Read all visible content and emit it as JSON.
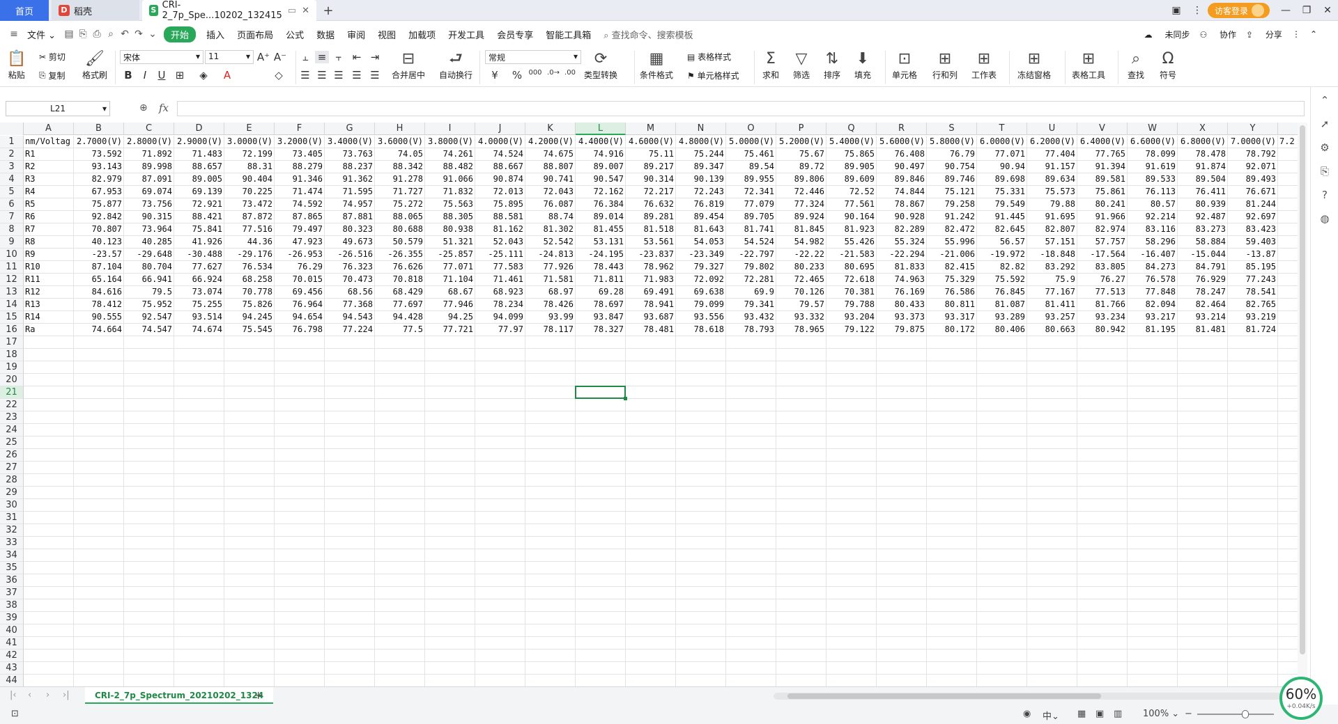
{
  "tabs": {
    "home": "首页",
    "daoke": "稻壳",
    "file": "CRI-2_7p_Spe...10202_132415",
    "new": "+"
  },
  "titlebar": {
    "login": "访客登录"
  },
  "menu": {
    "file": "文件",
    "items": [
      "开始",
      "插入",
      "页面布局",
      "公式",
      "数据",
      "审阅",
      "视图",
      "加载项",
      "开发工具",
      "会员专享",
      "智能工具箱"
    ],
    "search": "查找命令、搜索模板",
    "unsynced": "未同步",
    "collab": "协作",
    "share": "分享"
  },
  "ribbon": {
    "paste": "粘贴",
    "cut": "剪切",
    "copy": "复制",
    "format_painter": "格式刷",
    "font_name": "宋体",
    "font_size": "11",
    "merge_center": "合并居中",
    "wrap_text": "自动换行",
    "number_format": "常规",
    "type_convert": "类型转换",
    "cond_format": "条件格式",
    "table_style": "表格样式",
    "cell_style": "单元格样式",
    "sum": "求和",
    "filter": "筛选",
    "sort": "排序",
    "fill": "填充",
    "cell": "单元格",
    "row_col": "行和列",
    "worksheet": "工作表",
    "freeze": "冻结窗格",
    "table_tools": "表格工具",
    "find": "查找",
    "symbol": "符号"
  },
  "formula": {
    "namebox": "L21",
    "fx": "fx",
    "value": ""
  },
  "grid": {
    "columns": [
      "A",
      "B",
      "C",
      "D",
      "E",
      "F",
      "G",
      "H",
      "I",
      "J",
      "K",
      "L",
      "M",
      "N",
      "O",
      "P",
      "Q",
      "R",
      "S",
      "T",
      "U",
      "V",
      "W",
      "X",
      "Y"
    ],
    "active_col": "L",
    "active_row": 21,
    "row_count": 44,
    "header_row": [
      "nm/Voltag",
      "2.7000(V)",
      "2.8000(V)",
      "2.9000(V)",
      "3.0000(V)",
      "3.2000(V)",
      "3.4000(V)",
      "3.6000(V)",
      "3.8000(V)",
      "4.0000(V)",
      "4.2000(V)",
      "4.4000(V)",
      "4.6000(V)",
      "4.8000(V)",
      "5.0000(V)",
      "5.2000(V)",
      "5.4000(V)",
      "5.6000(V)",
      "5.8000(V)",
      "6.0000(V)",
      "6.2000(V)",
      "6.4000(V)",
      "6.6000(V)",
      "6.8000(V)",
      "7.0000(V)"
    ],
    "data_rows": [
      [
        "R1",
        "73.592",
        "71.892",
        "71.483",
        "72.199",
        "73.405",
        "73.763",
        "74.05",
        "74.261",
        "74.524",
        "74.675",
        "74.916",
        "75.11",
        "75.244",
        "75.461",
        "75.67",
        "75.865",
        "76.408",
        "76.79",
        "77.071",
        "77.404",
        "77.765",
        "78.099",
        "78.478",
        "78.792"
      ],
      [
        "R2",
        "93.143",
        "89.998",
        "88.657",
        "88.31",
        "88.279",
        "88.237",
        "88.342",
        "88.482",
        "88.667",
        "88.807",
        "89.007",
        "89.217",
        "89.347",
        "89.54",
        "89.72",
        "89.905",
        "90.497",
        "90.754",
        "90.94",
        "91.157",
        "91.394",
        "91.619",
        "91.874",
        "92.071"
      ],
      [
        "R3",
        "82.979",
        "87.091",
        "89.005",
        "90.404",
        "91.346",
        "91.362",
        "91.278",
        "91.066",
        "90.874",
        "90.741",
        "90.547",
        "90.314",
        "90.139",
        "89.955",
        "89.806",
        "89.609",
        "89.846",
        "89.746",
        "89.698",
        "89.634",
        "89.581",
        "89.533",
        "89.504",
        "89.493"
      ],
      [
        "R4",
        "67.953",
        "69.074",
        "69.139",
        "70.225",
        "71.474",
        "71.595",
        "71.727",
        "71.832",
        "72.013",
        "72.043",
        "72.162",
        "72.217",
        "72.243",
        "72.341",
        "72.446",
        "72.52",
        "74.844",
        "75.121",
        "75.331",
        "75.573",
        "75.861",
        "76.113",
        "76.411",
        "76.671"
      ],
      [
        "R5",
        "75.877",
        "73.756",
        "72.921",
        "73.472",
        "74.592",
        "74.957",
        "75.272",
        "75.563",
        "75.895",
        "76.087",
        "76.384",
        "76.632",
        "76.819",
        "77.079",
        "77.324",
        "77.561",
        "78.867",
        "79.258",
        "79.549",
        "79.88",
        "80.241",
        "80.57",
        "80.939",
        "81.244"
      ],
      [
        "R6",
        "92.842",
        "90.315",
        "88.421",
        "87.872",
        "87.865",
        "87.881",
        "88.065",
        "88.305",
        "88.581",
        "88.74",
        "89.014",
        "89.281",
        "89.454",
        "89.705",
        "89.924",
        "90.164",
        "90.928",
        "91.242",
        "91.445",
        "91.695",
        "91.966",
        "92.214",
        "92.487",
        "92.697"
      ],
      [
        "R7",
        "70.807",
        "73.964",
        "75.841",
        "77.516",
        "79.497",
        "80.323",
        "80.688",
        "80.938",
        "81.162",
        "81.302",
        "81.455",
        "81.518",
        "81.643",
        "81.741",
        "81.845",
        "81.923",
        "82.289",
        "82.472",
        "82.645",
        "82.807",
        "82.974",
        "83.116",
        "83.273",
        "83.423"
      ],
      [
        "R8",
        "40.123",
        "40.285",
        "41.926",
        "44.36",
        "47.923",
        "49.673",
        "50.579",
        "51.321",
        "52.043",
        "52.542",
        "53.131",
        "53.561",
        "54.053",
        "54.524",
        "54.982",
        "55.426",
        "55.324",
        "55.996",
        "56.57",
        "57.151",
        "57.757",
        "58.296",
        "58.884",
        "59.403"
      ],
      [
        "R9",
        "-23.57",
        "-29.648",
        "-30.488",
        "-29.176",
        "-26.953",
        "-26.516",
        "-26.355",
        "-25.857",
        "-25.111",
        "-24.813",
        "-24.195",
        "-23.837",
        "-23.349",
        "-22.797",
        "-22.22",
        "-21.583",
        "-22.294",
        "-21.006",
        "-19.972",
        "-18.848",
        "-17.564",
        "-16.407",
        "-15.044",
        "-13.87"
      ],
      [
        "R10",
        "87.104",
        "80.704",
        "77.627",
        "76.534",
        "76.29",
        "76.323",
        "76.626",
        "77.071",
        "77.583",
        "77.926",
        "78.443",
        "78.962",
        "79.327",
        "79.802",
        "80.233",
        "80.695",
        "81.833",
        "82.415",
        "82.82",
        "83.292",
        "83.805",
        "84.273",
        "84.791",
        "85.195"
      ],
      [
        "R11",
        "65.164",
        "66.941",
        "66.924",
        "68.258",
        "70.015",
        "70.473",
        "70.818",
        "71.104",
        "71.461",
        "71.581",
        "71.811",
        "71.983",
        "72.092",
        "72.281",
        "72.465",
        "72.618",
        "74.963",
        "75.329",
        "75.592",
        "75.9",
        "76.27",
        "76.578",
        "76.929",
        "77.243"
      ],
      [
        "R12",
        "84.616",
        "79.5",
        "73.074",
        "70.778",
        "69.456",
        "68.56",
        "68.429",
        "68.67",
        "68.923",
        "68.97",
        "69.28",
        "69.491",
        "69.638",
        "69.9",
        "70.126",
        "70.381",
        "76.169",
        "76.586",
        "76.845",
        "77.167",
        "77.513",
        "77.848",
        "78.247",
        "78.541"
      ],
      [
        "R13",
        "78.412",
        "75.952",
        "75.255",
        "75.826",
        "76.964",
        "77.368",
        "77.697",
        "77.946",
        "78.234",
        "78.426",
        "78.697",
        "78.941",
        "79.099",
        "79.341",
        "79.57",
        "79.788",
        "80.433",
        "80.811",
        "81.087",
        "81.411",
        "81.766",
        "82.094",
        "82.464",
        "82.765"
      ],
      [
        "R14",
        "90.555",
        "92.547",
        "93.514",
        "94.245",
        "94.654",
        "94.543",
        "94.428",
        "94.25",
        "94.099",
        "93.99",
        "93.847",
        "93.687",
        "93.556",
        "93.432",
        "93.332",
        "93.204",
        "93.373",
        "93.317",
        "93.289",
        "93.257",
        "93.234",
        "93.217",
        "93.214",
        "93.219"
      ],
      [
        "Ra",
        "74.664",
        "74.547",
        "74.674",
        "75.545",
        "76.798",
        "77.224",
        "77.5",
        "77.721",
        "77.97",
        "78.117",
        "78.327",
        "78.481",
        "78.618",
        "78.793",
        "78.965",
        "79.122",
        "79.875",
        "80.172",
        "80.406",
        "80.663",
        "80.942",
        "81.195",
        "81.481",
        "81.724"
      ]
    ],
    "partial_col_header": "7.2"
  },
  "sheet": {
    "name": "CRI-2_7p_Spectrum_20210202_1324",
    "add": "+"
  },
  "status": {
    "zoom": "100%",
    "input_mode": "中",
    "speed_pct": "60%",
    "speed_rate": "+0.04K/s"
  },
  "colors": {
    "accent": "#2aa85a",
    "home_tab": "#3a71e8",
    "login": "#f39c1f"
  }
}
